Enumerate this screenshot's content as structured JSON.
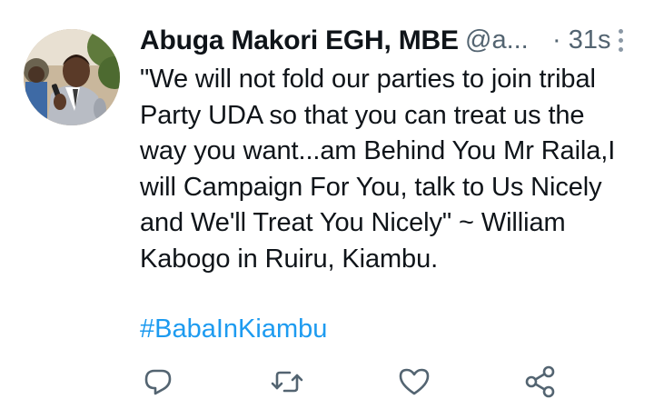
{
  "tweet": {
    "author": {
      "display_name": "Abuga Makori EGH, MBE",
      "handle": "@a...",
      "avatar_icon": "profile-photo"
    },
    "timestamp": "· 31s",
    "more_icon": "vertical-ellipsis-icon",
    "text_lines": [
      "\"We will not fold our parties to join tribal",
      "Party UDA so that you can treat us the",
      "way you want...am Behind You Mr Raila,I",
      "will Campaign For You, talk to Us Nicely",
      "and We'll Treat You Nicely\" ~ William",
      "Kabogo in Ruiru, Kiambu."
    ],
    "hashtag": "#BabaInKiambu",
    "actions": [
      {
        "name": "reply",
        "icon": "reply-icon"
      },
      {
        "name": "retweet",
        "icon": "retweet-icon"
      },
      {
        "name": "like",
        "icon": "heart-icon"
      },
      {
        "name": "share",
        "icon": "share-icon"
      }
    ],
    "colors": {
      "text": "#0f1419",
      "secondary": "#536471",
      "link": "#1d9bf0",
      "icon": "#536471"
    }
  }
}
